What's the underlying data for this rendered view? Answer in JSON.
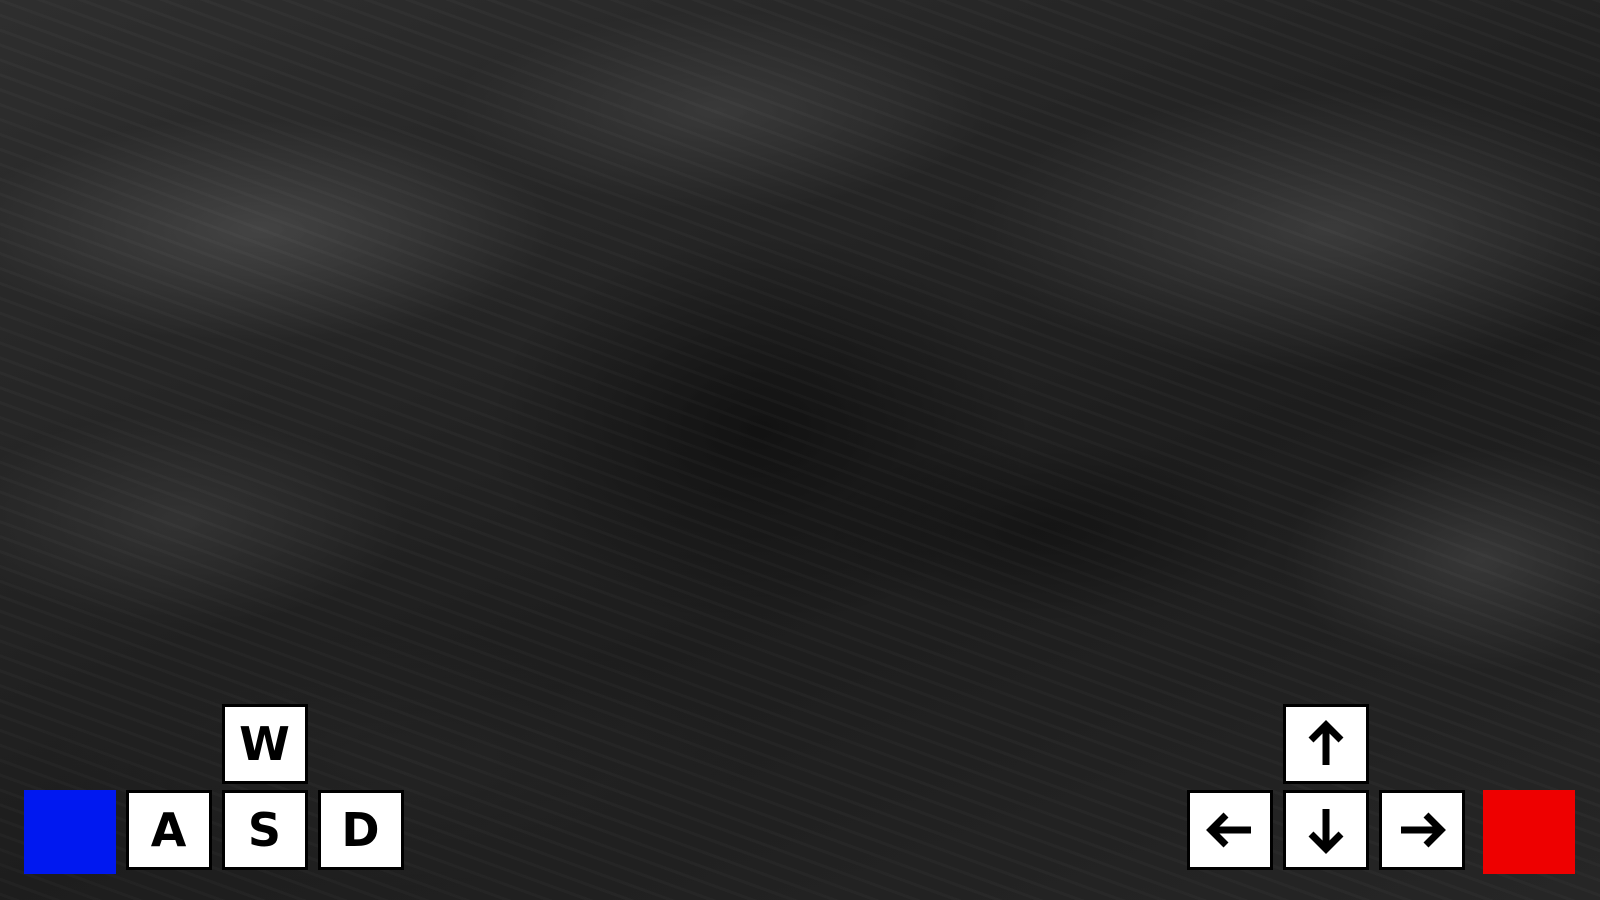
{
  "player1": {
    "color": "#0018f0",
    "keys": {
      "up": "W",
      "left": "A",
      "down": "S",
      "right": "D"
    }
  },
  "player2": {
    "color": "#ee0000",
    "keys": {
      "up": "arrow-up-icon",
      "left": "arrow-left-icon",
      "down": "arrow-down-icon",
      "right": "arrow-right-icon"
    }
  }
}
